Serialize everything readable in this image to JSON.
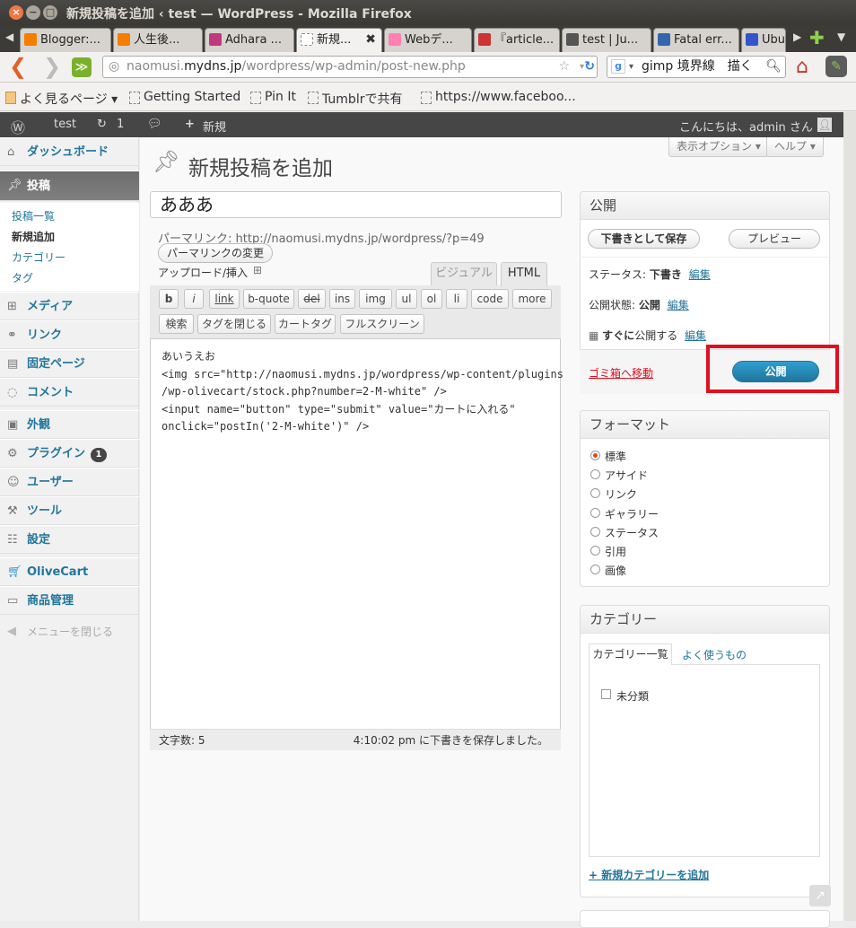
{
  "window": {
    "title": "新規投稿を追加 ‹ test — WordPress - Mozilla Firefox",
    "close": "×",
    "min": "−",
    "max": "□"
  },
  "tabs": [
    {
      "label": "Blogger:...",
      "color": "#f57d00"
    },
    {
      "label": "人生後...",
      "color": "#f57d00"
    },
    {
      "label": "Adhara ...",
      "color": "#c0397e"
    },
    {
      "label": "新規...",
      "color": "#ffffff",
      "close": "✖"
    },
    {
      "label": "Webデ...",
      "color": "#ff7fb0"
    },
    {
      "label": "『article...",
      "color": "#cc3333"
    },
    {
      "label": "test | Ju...",
      "color": "#555555"
    },
    {
      "label": "Fatal err...",
      "color": "#3366aa"
    },
    {
      "label": "Ubu",
      "color": "#3355cc"
    }
  ],
  "nav": {
    "url_prefix": "naomusi.",
    "url_host": "mydns.jp",
    "url_path": "/wordpress/wp-admin/post-new.php",
    "search_value": "gimp 境界線　描く"
  },
  "bookmarks": [
    "よく見るページ ▾",
    "Getting Started",
    "Pin It",
    "Tumblrで共有",
    "https://www.faceboo..."
  ],
  "adminbar": {
    "site": "test",
    "updates": "1",
    "new": "新規",
    "greeting": "こんにちは、admin さん !"
  },
  "sidebar": {
    "dashboard": "ダッシュボード",
    "posts": "投稿",
    "posts_sub": [
      "投稿一覧",
      "新規追加",
      "カテゴリー",
      "タグ"
    ],
    "media": "メディア",
    "links": "リンク",
    "pages": "固定ページ",
    "comments": "コメント",
    "appearance": "外観",
    "plugins": "プラグイン",
    "plugins_badge": "1",
    "users": "ユーザー",
    "tools": "ツール",
    "settings": "設定",
    "olivecart": "OliveCart",
    "products": "商品管理",
    "collapse": "メニューを閉じる"
  },
  "screen_options": "表示オプション ▾",
  "help": "ヘルプ ▾",
  "page_title": "新規投稿を追加",
  "post_title": "あああ",
  "permalink": {
    "label": "パーマリンク:",
    "url": "http://naomusi.mydns.jp/wordpress/?p=49",
    "button": "パーマリンクの変更"
  },
  "upload_label": "アップロード/挿入",
  "editor_tabs": {
    "visual": "ビジュアル",
    "html": "HTML"
  },
  "quicktags_row1": [
    "b",
    "i",
    "link",
    "b-quote",
    "del",
    "ins",
    "img",
    "ul",
    "ol",
    "li",
    "code",
    "more"
  ],
  "quicktags_row2": [
    "検索",
    "タグを閉じる",
    "カートタグ",
    "フルスクリーン"
  ],
  "editor_content": "あいうえお\n<img src=\"http://naomusi.mydns.jp/wordpress/wp-content/plugins\n/wp-olivecart/stock.php?number=2-M-white\" />\n<input name=\"button\" type=\"submit\" value=\"カートに入れる\"\nonclick=\"postIn('2-M-white')\" />",
  "word_count": "文字数: 5",
  "autosave_status": "4:10:02 pm に下書きを保存しました。",
  "publish": {
    "heading": "公開",
    "save_draft": "下書きとして保存",
    "preview": "プレビュー",
    "status_label": "ステータス:",
    "status_value": "下書き",
    "visibility_label": "公開状態:",
    "visibility_value": "公開",
    "schedule_bold": "すぐに",
    "schedule_rest": "公開する",
    "edit": "編集",
    "trash": "ゴミ箱へ移動",
    "publish_button": "公開"
  },
  "format": {
    "heading": "フォーマット",
    "options": [
      "標準",
      "アサイド",
      "リンク",
      "ギャラリー",
      "ステータス",
      "引用",
      "画像"
    ],
    "selected": "標準"
  },
  "category": {
    "heading": "カテゴリー",
    "tab_all": "カテゴリー一覧",
    "tab_popular": "よく使うもの",
    "items": [
      "未分類"
    ],
    "add_new": "+ 新規カテゴリーを追加"
  },
  "colors": {
    "highlight": "#e01020",
    "link": "#21759b",
    "publish": "#21759b"
  }
}
